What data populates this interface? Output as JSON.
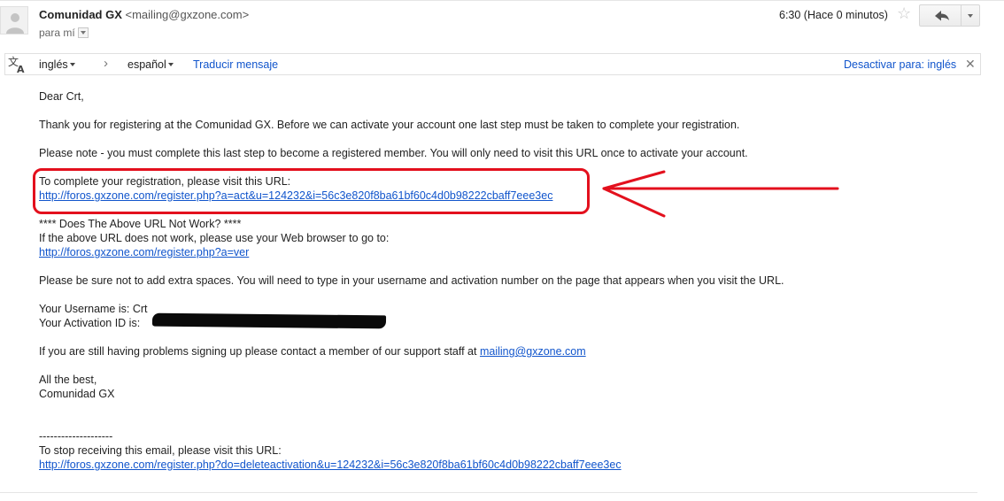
{
  "header": {
    "sender_name": "Comunidad GX",
    "sender_email": "<mailing@gxzone.com>",
    "recipient": "para mí",
    "time": "6:30 (Hace 0 minutos)"
  },
  "translate_bar": {
    "source_lang": "inglés",
    "target_lang": "español",
    "translate_label": "Traducir mensaje",
    "disable_label": "Desactivar para: inglés"
  },
  "body": {
    "greeting": "Dear Crt,",
    "para1": "Thank you for registering at the Comunidad GX. Before we can activate your account one last step must be taken to complete your registration.",
    "para2": "Please note - you must complete this last step to become a registered member. You will only need to visit this URL once to activate your account.",
    "visit_label": "To complete your registration, please visit this URL:",
    "activation_url": "http://foros.gxzone.com/register.php?a=act&u=124232&i=56c3e820f8ba61bf60c4d0b98222cbaff7eee3ec",
    "not_work_title": "**** Does The Above URL Not Work? ****",
    "not_work_text": "If the above URL does not work, please use your Web browser to go to:",
    "verify_url": "http://foros.gxzone.com/register.php?a=ver",
    "spaces_note": "Please be sure not to add extra spaces. You will need to type in your username and activation number on the page that appears when you visit the URL.",
    "username_line": "Your Username is: Crt",
    "activation_label": "Your Activation ID is:",
    "support_text": "If you are still having problems signing up please contact a member of our support staff at",
    "support_email": "mailing@gxzone.com",
    "signoff": "All the best,",
    "signature": "Comunidad GX",
    "separator": "--------------------",
    "stop_text": "To stop receiving this email, please visit this URL:",
    "stop_url": "http://foros.gxzone.com/register.php?do=deleteactivation&u=124232&i=56c3e820f8ba61bf60c4d0b98222cbaff7eee3ec"
  },
  "colors": {
    "link": "#1155cc",
    "annotation": "#e3101d"
  }
}
